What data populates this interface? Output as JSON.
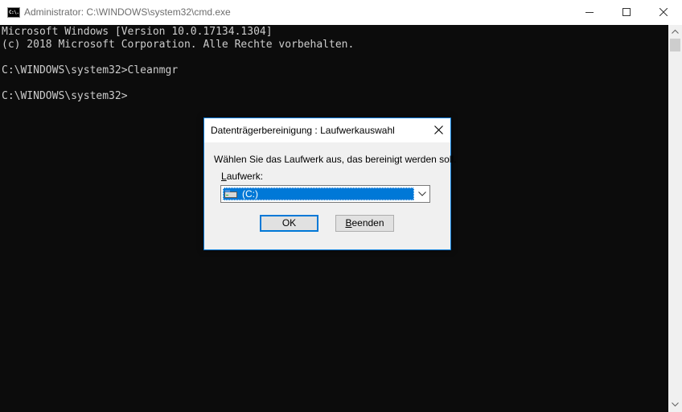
{
  "window": {
    "title": "Administrator: C:\\WINDOWS\\system32\\cmd.exe",
    "icon_text": "C:\\."
  },
  "console": {
    "lines": [
      "Microsoft Windows [Version 10.0.17134.1304]",
      "(c) 2018 Microsoft Corporation. Alle Rechte vorbehalten.",
      "C:\\WINDOWS\\system32>Cleanmgr",
      "C:\\WINDOWS\\system32>"
    ]
  },
  "dialog": {
    "title": "Datenträgerbereinigung : Laufwerkauswahl",
    "message": "Wählen Sie das Laufwerk aus, das bereinigt werden soll.",
    "drive_label_access": "L",
    "drive_label_rest": "aufwerk:",
    "drive_selected": "(C:)",
    "ok_label": "OK",
    "exit_label_access": "B",
    "exit_label_rest": "eenden"
  },
  "colors": {
    "accent": "#0078d7",
    "console_bg": "#0c0c0c",
    "console_text": "#cccccc",
    "dialog_bg": "#f0f0f0"
  },
  "icons": [
    "cmd-app-icon",
    "minimize-icon",
    "maximize-icon",
    "close-icon",
    "chevron-up-icon",
    "chevron-down-icon",
    "drive-icon",
    "dropdown-arrow-icon"
  ]
}
